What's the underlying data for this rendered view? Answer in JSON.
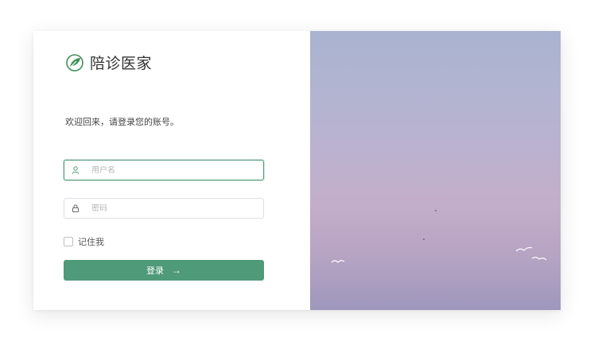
{
  "brand": {
    "name": "陪诊医家",
    "logo_icon": "leaf-logo-icon",
    "accent": "#4f9a78"
  },
  "login": {
    "welcome": "欢迎回来，请登录您的账号。",
    "username": {
      "placeholder": "用户名",
      "value": "",
      "icon": "user-icon"
    },
    "password": {
      "placeholder": "密码",
      "value": "",
      "icon": "lock-icon"
    },
    "remember_label": "记住我",
    "remember_checked": false,
    "submit_label": "登录",
    "submit_icon": "arrow-right-icon"
  }
}
